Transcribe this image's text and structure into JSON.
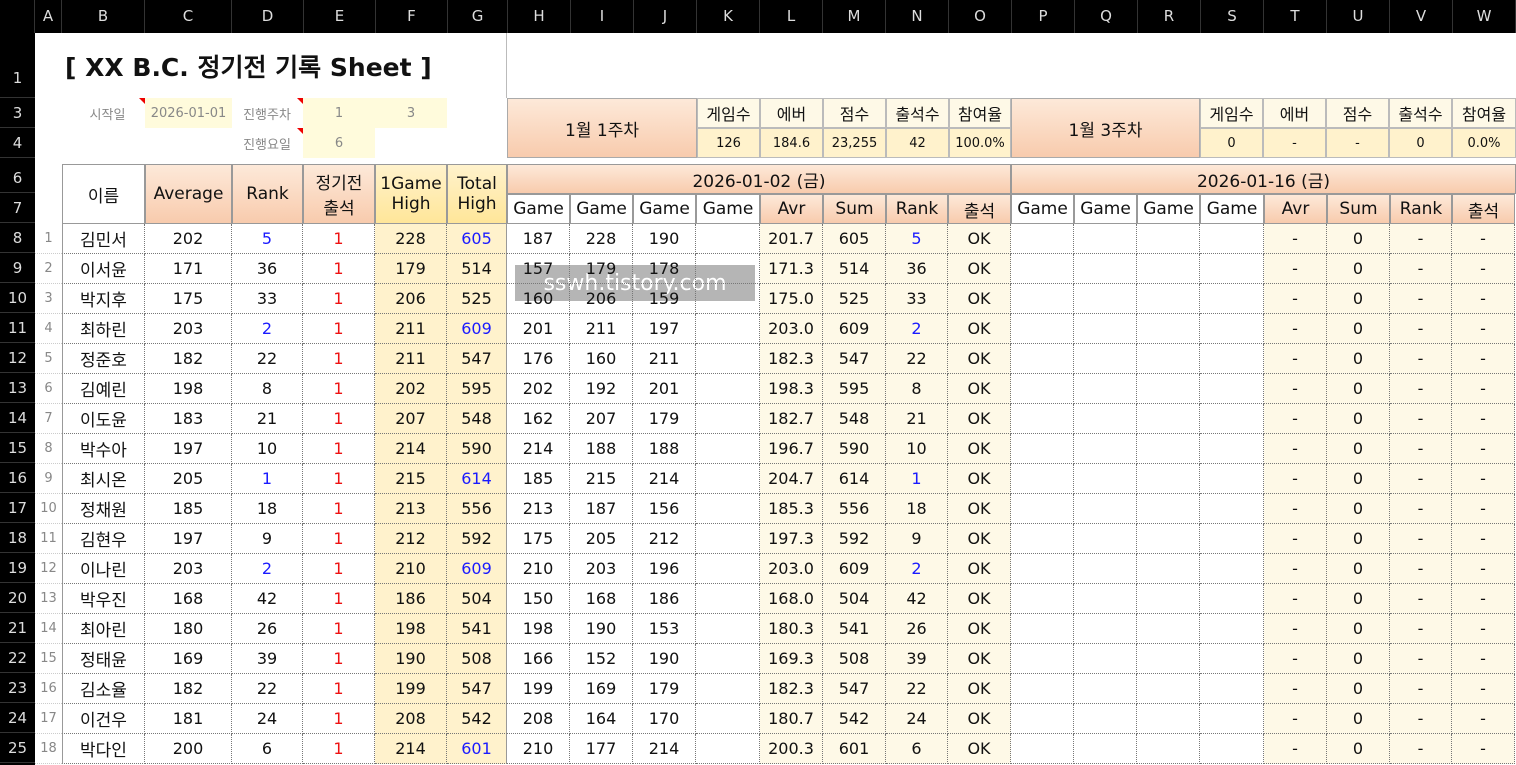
{
  "columns": [
    "A",
    "B",
    "C",
    "D",
    "E",
    "F",
    "G",
    "H",
    "I",
    "J",
    "K",
    "L",
    "M",
    "N",
    "O",
    "P",
    "Q",
    "R",
    "S",
    "T",
    "U",
    "V",
    "W"
  ],
  "row_numbers": [
    "1",
    "3",
    "4",
    "6",
    "7",
    "8",
    "9",
    "10",
    "11",
    "12",
    "13",
    "14",
    "15",
    "16",
    "17",
    "18",
    "19",
    "20",
    "21",
    "22",
    "23",
    "24",
    "25"
  ],
  "title": "[ XX B.C. 정기전 기록 Sheet ]",
  "meta": {
    "start_label": "시작일",
    "start_value": "2026-01-01",
    "week_label": "진행주차",
    "week_value1": "1",
    "week_value2": "3",
    "day_label": "진행요일",
    "day_value": "6"
  },
  "summary1": {
    "title": "1월 1주차",
    "labels": [
      "게임수",
      "에버",
      "점수",
      "출석수",
      "참여율"
    ],
    "values": [
      "126",
      "184.6",
      "23,255",
      "42",
      "100.0%"
    ]
  },
  "summary2": {
    "title": "1월 3주차",
    "labels": [
      "게임수",
      "에버",
      "점수",
      "출석수",
      "참여율"
    ],
    "values": [
      "0",
      "-",
      "-",
      "0",
      "0.0%"
    ]
  },
  "left_headers": {
    "name": "이름",
    "average": "Average",
    "rank": "Rank",
    "attend1": "정기전",
    "attend2": "출석",
    "high1_1": "1Game",
    "high1_2": "High",
    "total1": "Total",
    "total2": "High"
  },
  "week1": {
    "date": "2026-01-02 (금)",
    "sub": [
      "Game",
      "Game",
      "Game",
      "Game",
      "Avr",
      "Sum",
      "Rank",
      "출석"
    ]
  },
  "week2": {
    "date": "2026-01-16 (금)",
    "sub": [
      "Game",
      "Game",
      "Game",
      "Game",
      "Avr",
      "Sum",
      "Rank",
      "출석"
    ]
  },
  "watermark": "sswh.tistory.com",
  "players": [
    {
      "no": "1",
      "name": "김민서",
      "avg": "202",
      "rank": "5",
      "att": "1",
      "high": "228",
      "total": "605",
      "g1": "187",
      "g2": "228",
      "g3": "190",
      "avr": "201.7",
      "sum": "605",
      "wrank": "5",
      "ok": "OK"
    },
    {
      "no": "2",
      "name": "이서윤",
      "avg": "171",
      "rank": "36",
      "att": "1",
      "high": "179",
      "total": "514",
      "g1": "157",
      "g2": "179",
      "g3": "178",
      "avr": "171.3",
      "sum": "514",
      "wrank": "36",
      "ok": "OK"
    },
    {
      "no": "3",
      "name": "박지후",
      "avg": "175",
      "rank": "33",
      "att": "1",
      "high": "206",
      "total": "525",
      "g1": "160",
      "g2": "206",
      "g3": "159",
      "avr": "175.0",
      "sum": "525",
      "wrank": "33",
      "ok": "OK"
    },
    {
      "no": "4",
      "name": "최하린",
      "avg": "203",
      "rank": "2",
      "att": "1",
      "high": "211",
      "total": "609",
      "g1": "201",
      "g2": "211",
      "g3": "197",
      "avr": "203.0",
      "sum": "609",
      "wrank": "2",
      "ok": "OK"
    },
    {
      "no": "5",
      "name": "정준호",
      "avg": "182",
      "rank": "22",
      "att": "1",
      "high": "211",
      "total": "547",
      "g1": "176",
      "g2": "160",
      "g3": "211",
      "avr": "182.3",
      "sum": "547",
      "wrank": "22",
      "ok": "OK"
    },
    {
      "no": "6",
      "name": "김예린",
      "avg": "198",
      "rank": "8",
      "att": "1",
      "high": "202",
      "total": "595",
      "g1": "202",
      "g2": "192",
      "g3": "201",
      "avr": "198.3",
      "sum": "595",
      "wrank": "8",
      "ok": "OK"
    },
    {
      "no": "7",
      "name": "이도윤",
      "avg": "183",
      "rank": "21",
      "att": "1",
      "high": "207",
      "total": "548",
      "g1": "162",
      "g2": "207",
      "g3": "179",
      "avr": "182.7",
      "sum": "548",
      "wrank": "21",
      "ok": "OK"
    },
    {
      "no": "8",
      "name": "박수아",
      "avg": "197",
      "rank": "10",
      "att": "1",
      "high": "214",
      "total": "590",
      "g1": "214",
      "g2": "188",
      "g3": "188",
      "avr": "196.7",
      "sum": "590",
      "wrank": "10",
      "ok": "OK"
    },
    {
      "no": "9",
      "name": "최시온",
      "avg": "205",
      "rank": "1",
      "att": "1",
      "high": "215",
      "total": "614",
      "g1": "185",
      "g2": "215",
      "g3": "214",
      "avr": "204.7",
      "sum": "614",
      "wrank": "1",
      "ok": "OK"
    },
    {
      "no": "10",
      "name": "정채원",
      "avg": "185",
      "rank": "18",
      "att": "1",
      "high": "213",
      "total": "556",
      "g1": "213",
      "g2": "187",
      "g3": "156",
      "avr": "185.3",
      "sum": "556",
      "wrank": "18",
      "ok": "OK"
    },
    {
      "no": "11",
      "name": "김현우",
      "avg": "197",
      "rank": "9",
      "att": "1",
      "high": "212",
      "total": "592",
      "g1": "175",
      "g2": "205",
      "g3": "212",
      "avr": "197.3",
      "sum": "592",
      "wrank": "9",
      "ok": "OK"
    },
    {
      "no": "12",
      "name": "이나린",
      "avg": "203",
      "rank": "2",
      "att": "1",
      "high": "210",
      "total": "609",
      "g1": "210",
      "g2": "203",
      "g3": "196",
      "avr": "203.0",
      "sum": "609",
      "wrank": "2",
      "ok": "OK"
    },
    {
      "no": "13",
      "name": "박우진",
      "avg": "168",
      "rank": "42",
      "att": "1",
      "high": "186",
      "total": "504",
      "g1": "150",
      "g2": "168",
      "g3": "186",
      "avr": "168.0",
      "sum": "504",
      "wrank": "42",
      "ok": "OK"
    },
    {
      "no": "14",
      "name": "최아린",
      "avg": "180",
      "rank": "26",
      "att": "1",
      "high": "198",
      "total": "541",
      "g1": "198",
      "g2": "190",
      "g3": "153",
      "avr": "180.3",
      "sum": "541",
      "wrank": "26",
      "ok": "OK"
    },
    {
      "no": "15",
      "name": "정태윤",
      "avg": "169",
      "rank": "39",
      "att": "1",
      "high": "190",
      "total": "508",
      "g1": "166",
      "g2": "152",
      "g3": "190",
      "avr": "169.3",
      "sum": "508",
      "wrank": "39",
      "ok": "OK"
    },
    {
      "no": "16",
      "name": "김소율",
      "avg": "182",
      "rank": "22",
      "att": "1",
      "high": "199",
      "total": "547",
      "g1": "199",
      "g2": "169",
      "g3": "179",
      "avr": "182.3",
      "sum": "547",
      "wrank": "22",
      "ok": "OK"
    },
    {
      "no": "17",
      "name": "이건우",
      "avg": "181",
      "rank": "24",
      "att": "1",
      "high": "208",
      "total": "542",
      "g1": "208",
      "g2": "164",
      "g3": "170",
      "avr": "180.7",
      "sum": "542",
      "wrank": "24",
      "ok": "OK"
    },
    {
      "no": "18",
      "name": "박다인",
      "avg": "200",
      "rank": "6",
      "att": "1",
      "high": "214",
      "total": "601",
      "g1": "210",
      "g2": "177",
      "g3": "214",
      "avr": "200.3",
      "sum": "601",
      "wrank": "6",
      "ok": "OK"
    }
  ],
  "week2_row": {
    "avr": "-",
    "sum": "0",
    "rank": "-",
    "ok": "-"
  },
  "blue_ranks": [
    "1",
    "2",
    "5"
  ],
  "blue_totals_min": 600
}
